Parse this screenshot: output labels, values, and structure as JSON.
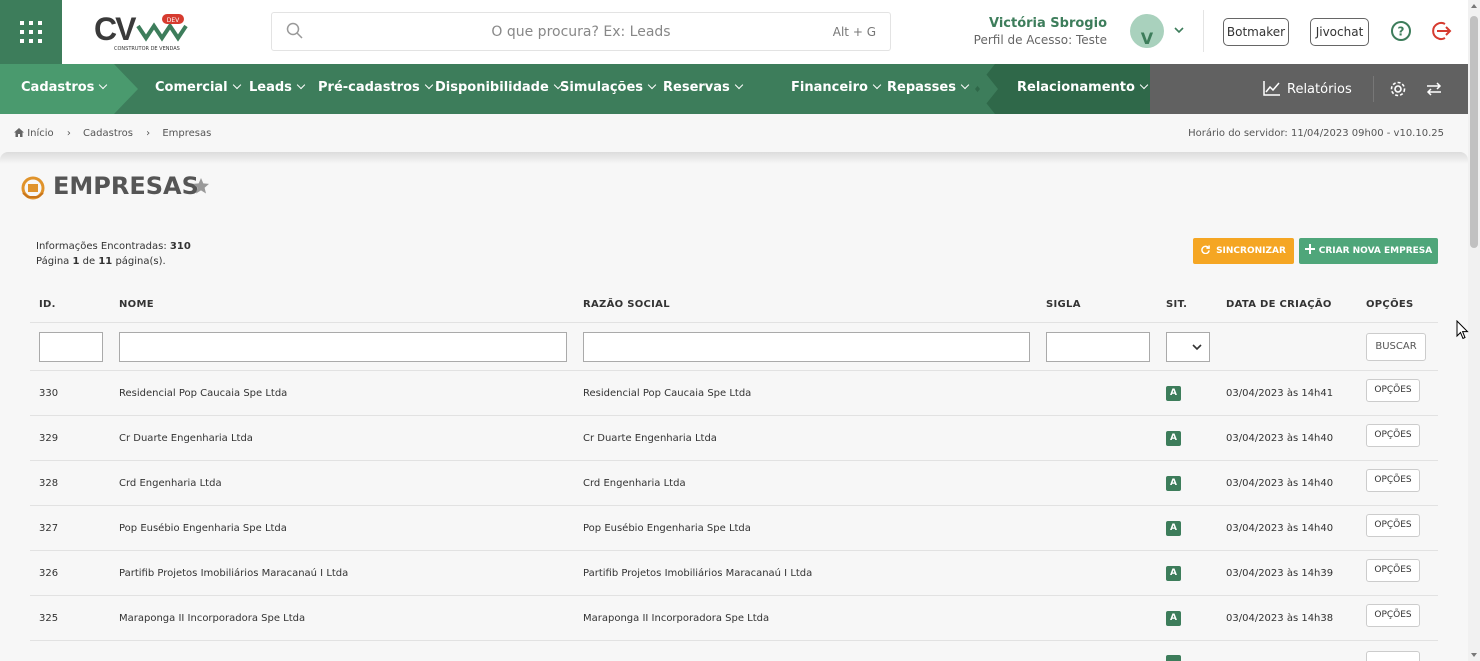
{
  "header": {
    "logo_text": "CV",
    "logo_badge": "DEV",
    "logo_sub": "CONSTRUTOR DE VENDAS",
    "search_placeholder": "O que procura? Ex: Leads",
    "search_shortcut": "Alt + G",
    "user_name": "Victória Sbrogio",
    "user_profile": "Perfil de Acesso: Teste",
    "avatar_initial": "V",
    "btn_botmaker": "Botmaker",
    "btn_jivochat": "Jivochat"
  },
  "nav": {
    "items": [
      "Cadastros",
      "Comercial",
      "Leads",
      "Pré-cadastros",
      "Disponibilidade",
      "Simulações",
      "Reservas",
      "Financeiro",
      "Repasses",
      "Relacionamento"
    ],
    "relatorios": "Relatórios"
  },
  "breadcrumb": [
    "Início",
    "Cadastros",
    "Empresas"
  ],
  "server_time": "Horário do servidor: 11/04/2023 09h00 - v10.10.25",
  "page": {
    "title": "EMPRESAS",
    "info_label": "Informações Encontradas:",
    "info_count": "310",
    "page_prefix": "Página",
    "page_current": "1",
    "page_of": "de",
    "page_total": "11",
    "page_suffix": "página(s).",
    "btn_sync": "SINCRONIZAR",
    "btn_new": "CRIAR NOVA EMPRESA"
  },
  "table": {
    "headers": [
      "ID.",
      "NOME",
      "RAZÃO SOCIAL",
      "SIGLA",
      "SIT.",
      "DATA DE CRIAÇÃO",
      "OPÇÕES"
    ],
    "buscar": "BUSCAR",
    "options_label": "OPÇÕES",
    "rows": [
      {
        "id": "330",
        "nome": "Residencial Pop Caucaia Spe Ltda",
        "razao": "Residencial Pop Caucaia Spe Ltda",
        "sigla": "",
        "sit": "A",
        "data": "03/04/2023 às 14h41"
      },
      {
        "id": "329",
        "nome": "Cr Duarte Engenharia Ltda",
        "razao": "Cr Duarte Engenharia Ltda",
        "sigla": "",
        "sit": "A",
        "data": "03/04/2023 às 14h40"
      },
      {
        "id": "328",
        "nome": "Crd Engenharia Ltda",
        "razao": "Crd Engenharia Ltda",
        "sigla": "",
        "sit": "A",
        "data": "03/04/2023 às 14h40"
      },
      {
        "id": "327",
        "nome": "Pop Eusébio Engenharia Spe Ltda",
        "razao": "Pop Eusébio Engenharia Spe Ltda",
        "sigla": "",
        "sit": "A",
        "data": "03/04/2023 às 14h40"
      },
      {
        "id": "326",
        "nome": "Partifib Projetos Imobiliários Maracanaú I Ltda",
        "razao": "Partifib Projetos Imobiliários Maracanaú I Ltda",
        "sigla": "",
        "sit": "A",
        "data": "03/04/2023 às 14h39"
      },
      {
        "id": "325",
        "nome": "Maraponga II Incorporadora Spe Ltda",
        "razao": "Maraponga II Incorporadora Spe Ltda",
        "sigla": "",
        "sit": "A",
        "data": "03/04/2023 às 14h38"
      }
    ]
  },
  "colors": {
    "brand_green": "#3d7d5b",
    "nav_gray": "#616161",
    "sync_orange": "#f5a623",
    "new_green": "#4fa67a"
  }
}
